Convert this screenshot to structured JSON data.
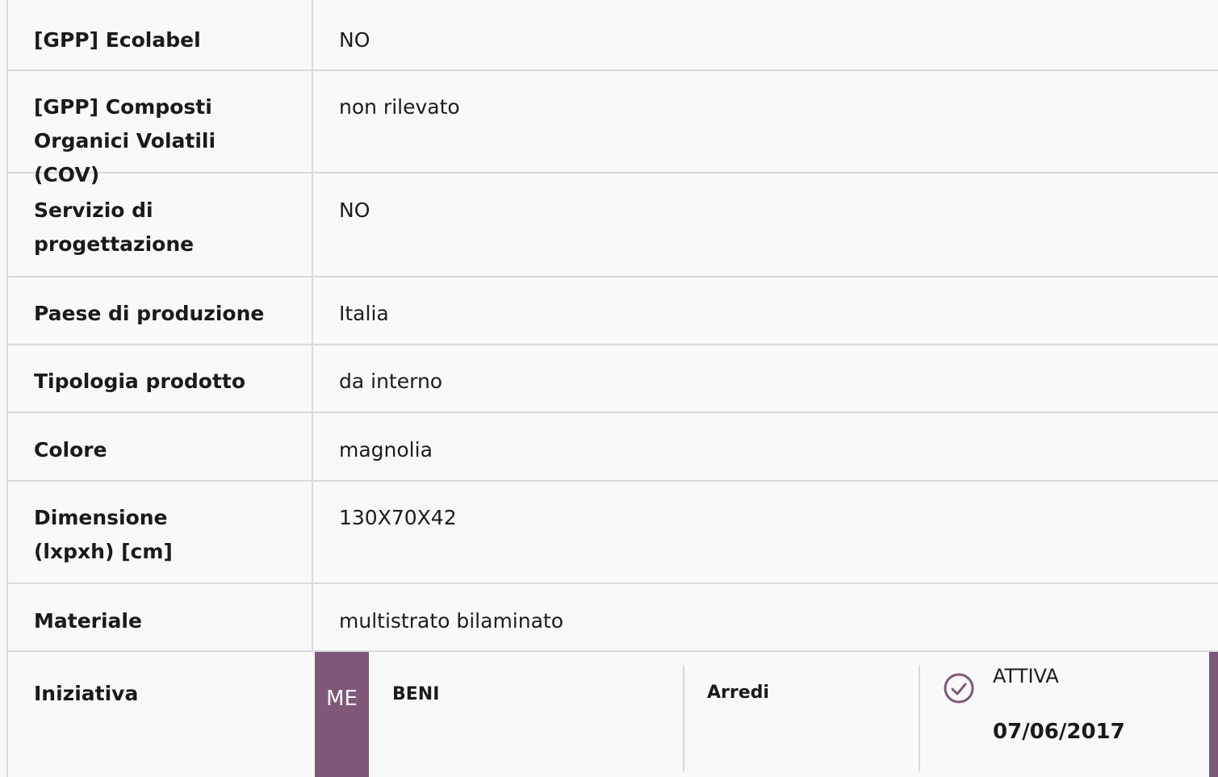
{
  "rows": [
    {
      "label": "[GPP] Ecolabel",
      "value": "NO"
    },
    {
      "label": "[GPP] Composti Organici Volatili (COV)",
      "value": "non rilevato"
    },
    {
      "label": "Servizio di progettazione",
      "value": "NO"
    },
    {
      "label": "Paese di produzione",
      "value": "Italia"
    },
    {
      "label": "Tipologia prodotto",
      "value": "da interno"
    },
    {
      "label": "Colore",
      "value": "magnolia"
    },
    {
      "label": "Dimensione (lxpxh) [cm]",
      "value": "130X70X42"
    },
    {
      "label": "Materiale",
      "value": "multistrato bilaminato"
    }
  ],
  "iniziativa": {
    "label": "Iniziativa",
    "badge": "ME",
    "type": "BENI",
    "category": "Arredi",
    "status": "ATTIVA",
    "date": "07/06/2017",
    "check_icon": "check-circle-icon"
  },
  "colors": {
    "accent": "#7d5878",
    "border": "#d9d9d9",
    "background": "#f9f9f9"
  }
}
